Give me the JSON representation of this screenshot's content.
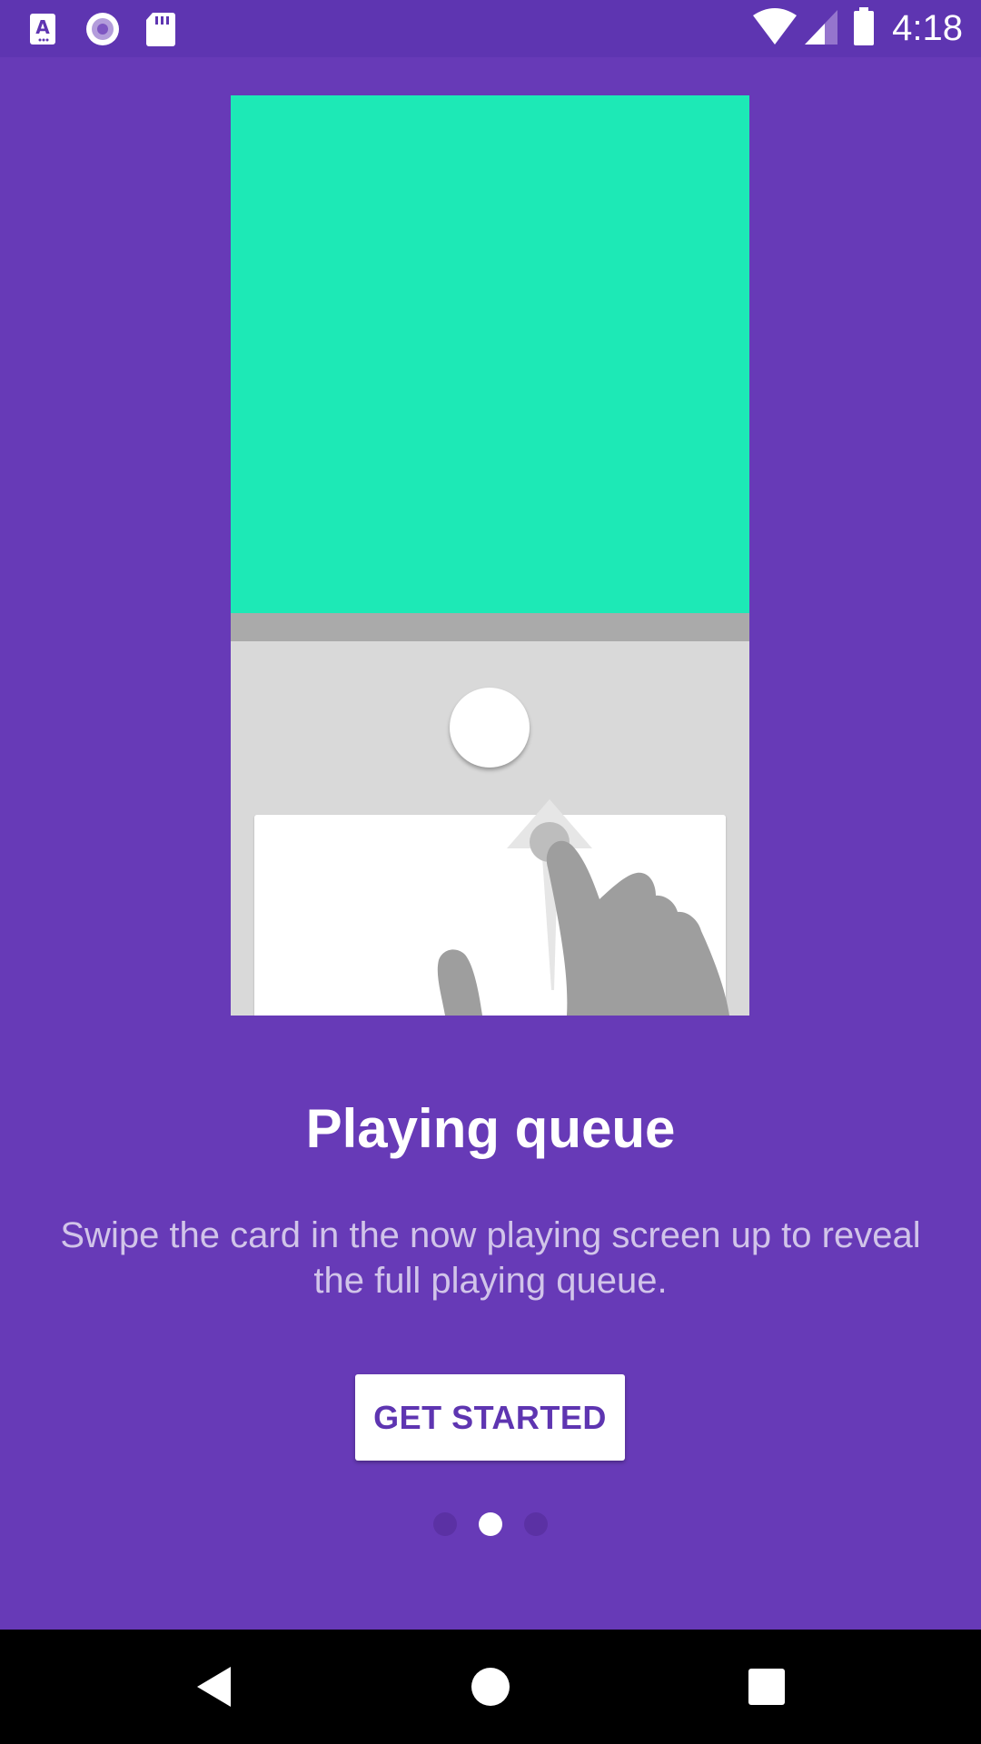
{
  "status_bar": {
    "time": "4:18",
    "left_icons": [
      "font-a-icon",
      "media-circle-icon",
      "sd-card-icon"
    ],
    "right_icons": [
      "wifi-icon",
      "signal-icon",
      "battery-icon"
    ]
  },
  "onboarding": {
    "title": "Playing queue",
    "description": "Swipe the card in the now playing screen up to reveal the full playing queue.",
    "button_label": "GET STARTED",
    "page_count": 3,
    "current_page": 2
  },
  "colors": {
    "background": "#673AB7",
    "status_bar": "#5E35B1",
    "accent": "#1DE9B6",
    "button_text": "#5E35B1"
  },
  "nav_bar": {
    "buttons": [
      "back-icon",
      "home-icon",
      "recents-icon"
    ]
  }
}
